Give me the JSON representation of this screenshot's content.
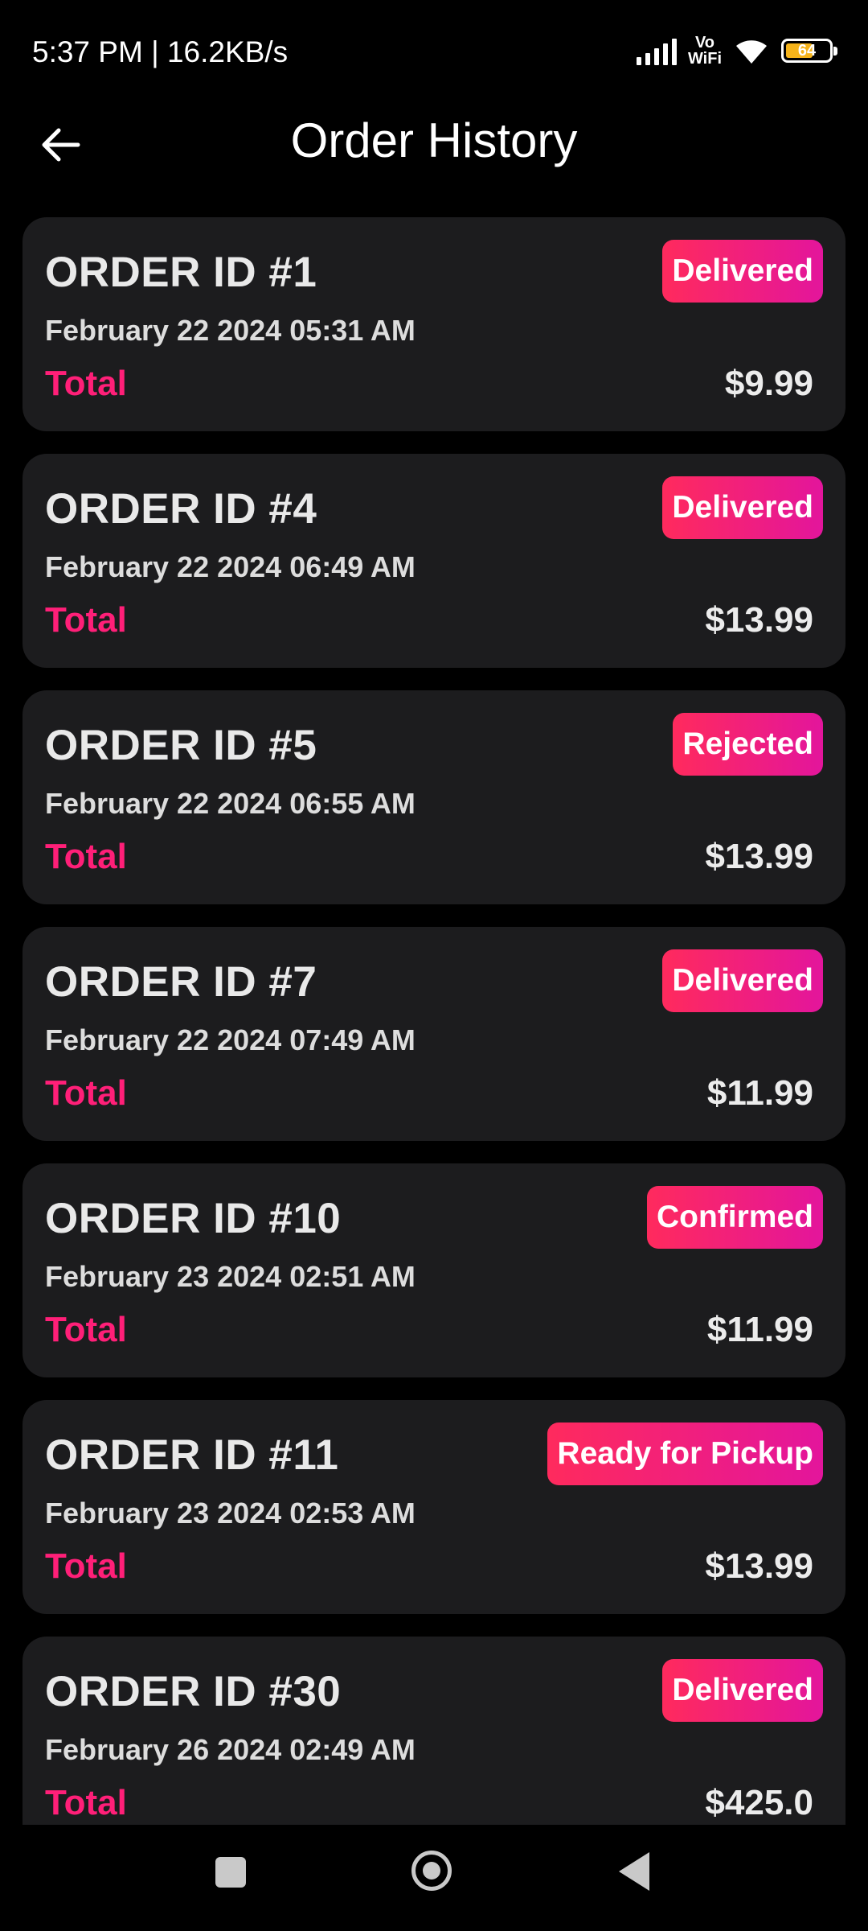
{
  "status_bar": {
    "time": "5:37 PM | 16.2KB/s",
    "network": "Vo\nWiFi",
    "battery": "64",
    "battery_level_percent": 64
  },
  "header": {
    "back_icon": "arrow-left-icon",
    "title": "Order History"
  },
  "orders": [
    {
      "id": "ORDER ID #1",
      "date": "February 22 2024 05:31 AM",
      "total_label": "Total",
      "total": "$9.99",
      "status": "Delivered"
    },
    {
      "id": "ORDER ID #4",
      "date": "February 22 2024 06:49 AM",
      "total_label": "Total",
      "total": "$13.99",
      "status": "Delivered"
    },
    {
      "id": "ORDER ID #5",
      "date": "February 22 2024 06:55 AM",
      "total_label": "Total",
      "total": "$13.99",
      "status": "Rejected"
    },
    {
      "id": "ORDER ID #7",
      "date": "February 22 2024 07:49 AM",
      "total_label": "Total",
      "total": "$11.99",
      "status": "Delivered"
    },
    {
      "id": "ORDER ID #10",
      "date": "February 23 2024 02:51 AM",
      "total_label": "Total",
      "total": "$11.99",
      "status": "Confirmed"
    },
    {
      "id": "ORDER ID #11",
      "date": "February 23 2024 02:53 AM",
      "total_label": "Total",
      "total": "$13.99",
      "status": "Ready for Pickup"
    },
    {
      "id": "ORDER ID #30",
      "date": "February 26 2024 02:49 AM",
      "total_label": "Total",
      "total": "$425.0",
      "status": "Delivered"
    }
  ],
  "colors": {
    "background": "#000000",
    "card": "#1c1c1e",
    "accent": "#ff1f78",
    "badge_gradient_start": "#ff2a5d",
    "badge_gradient_end": "#e3159c"
  },
  "nav_bar": {
    "recents_icon": "square-icon",
    "home_icon": "circle-home-icon",
    "back_icon": "triangle-back-icon"
  }
}
